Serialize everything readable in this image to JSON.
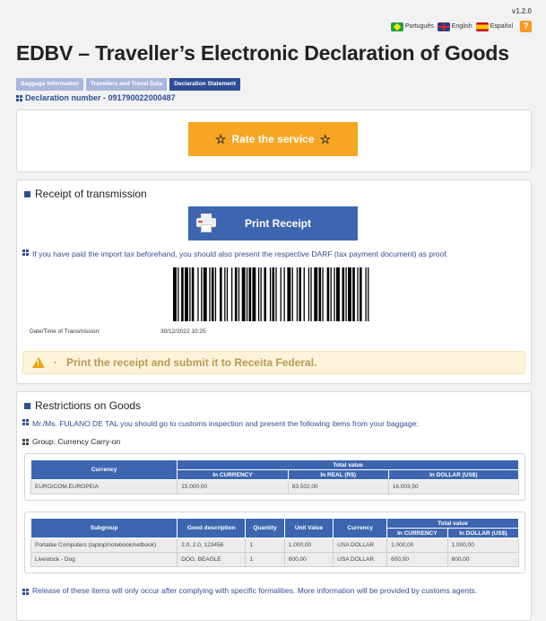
{
  "header": {
    "version": "v1.2.0",
    "languages": [
      {
        "label": "Português",
        "flag": "brazil-flag-icon"
      },
      {
        "label": "English",
        "flag": "uk-flag-icon"
      },
      {
        "label": "Español",
        "flag": "spain-flag-icon"
      }
    ],
    "help_label": "?",
    "title": "EDBV – Traveller’s Electronic Declaration of Goods"
  },
  "tabs": [
    {
      "label": "Baggage Information",
      "active": false
    },
    {
      "label": "Travellers and Travel Data",
      "active": false
    },
    {
      "label": "Declaration Statement",
      "active": true
    }
  ],
  "declaration_number": "Declaration number - 091790022000487",
  "rate": {
    "label": "Rate the service"
  },
  "receipt": {
    "title": "Receipt of transmission",
    "print_label": "Print Receipt",
    "info": "If you have paid the import tax beforehand, you should also present the respective DARF (tax payment document) as proof.",
    "datetime_label": "Date/Time of Transmission:",
    "datetime_value": "30/12/2022 10:25",
    "warning": "Print the receipt and submit it to Receita Federal."
  },
  "restrictions": {
    "title": "Restrictions on Goods",
    "intro": "Mr./Ms. FULANO DE TAL you should go to customs inspection and present the following items from your baggage:",
    "group": "Group: Currency Carry-on",
    "currency_table": {
      "headers": {
        "currency": "Currency",
        "total": "Total value",
        "in_currency": "In CURRENCY",
        "in_real": "In REAL (R$)",
        "in_dollar": "In DOLLAR (US$)"
      },
      "rows": [
        {
          "currency": "EURO/COM.EUROPEIA",
          "in_currency": "15.000,00",
          "in_real": "83.502,00",
          "in_dollar": "16.003,50"
        }
      ]
    },
    "goods_table": {
      "headers": {
        "subgroup": "Subgroup",
        "description": "Good description",
        "quantity": "Quantity",
        "unit_value": "Unit Value",
        "currency": "Currency",
        "total": "Total value",
        "in_currency": "In CURRENCY",
        "in_dollar": "In DOLLAR (US$)"
      },
      "rows": [
        {
          "subgroup": "Portable Computers (laptop/notebook/netbook)",
          "description": "2.0, 2.0, 123456",
          "quantity": "1",
          "unit_value": "1.000,00",
          "currency": "USA DOLLAR",
          "in_currency": "1.000,00",
          "in_dollar": "1.000,00"
        },
        {
          "subgroup": "Livestock - Dog",
          "description": "DOG, BEAGLE",
          "quantity": "1",
          "unit_value": "600,00",
          "currency": "USA DOLLAR",
          "in_currency": "600,00",
          "in_dollar": "600,00"
        }
      ]
    },
    "release_note": "Release of these items will only occur after complying with specific formalities. More information will be provided by customs agents."
  }
}
